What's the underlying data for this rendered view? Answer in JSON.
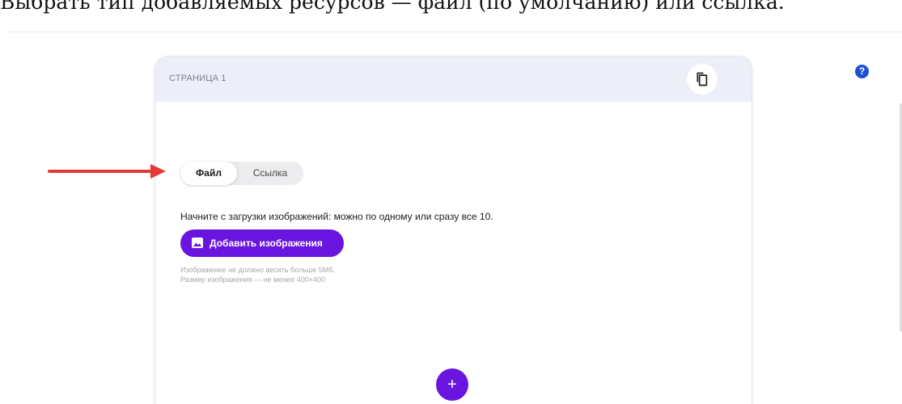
{
  "caption": "Выбрать тип добавляемых ресурсов — файл (по умолчанию) или ссылка.",
  "help": {
    "glyph": "?"
  },
  "page": {
    "title": "СТРАНИЦА 1",
    "copy_icon": "copy-icon"
  },
  "resource_type": {
    "tabs": [
      {
        "label": "Файл",
        "selected": true
      },
      {
        "label": "Ссылка",
        "selected": false
      }
    ]
  },
  "upload": {
    "instruction": "Начните с загрузки изображений: можно по одному или сразу все 10.",
    "button_label": "Добавить изображения",
    "button_icon": "image-icon",
    "hints": [
      "Изображение не должно весить больше 5Мб.",
      "Размер изображения — не менее 400×400"
    ]
  },
  "add_page": {
    "glyph": "+"
  },
  "colors": {
    "accent": "#6a14e0",
    "header_bg": "#eceef8",
    "annotation": "#e53935",
    "help": "#1d4fd8"
  }
}
